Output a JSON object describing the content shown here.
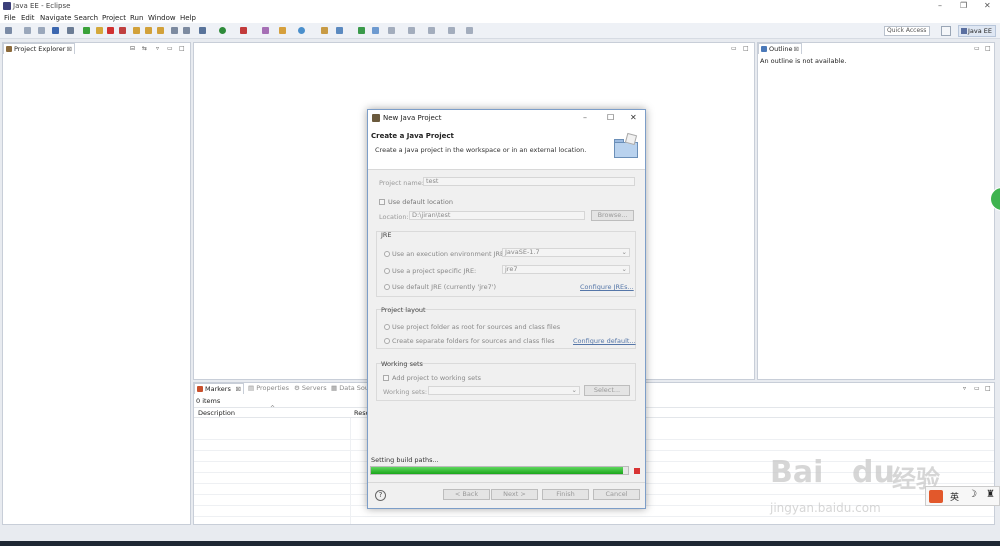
{
  "window": {
    "title": "Java EE - Eclipse"
  },
  "menu": [
    "File",
    "Edit",
    "Navigate",
    "Search",
    "Project",
    "Run",
    "Window",
    "Help"
  ],
  "toolbar": {
    "quick_access": "Quick Access",
    "perspective": "Java EE"
  },
  "project_explorer": {
    "tab": "Project Explorer"
  },
  "outline": {
    "tab": "Outline",
    "message": "An outline is not available."
  },
  "bottom": {
    "tabs": [
      "Markers",
      "Properties",
      "Servers",
      "Data Sou"
    ],
    "count": "0 items",
    "columns": [
      "Description",
      "Reso"
    ]
  },
  "dialog": {
    "title": "New Java Project",
    "heading": "Create a Java Project",
    "description": "Create a Java project in the workspace or in an external location.",
    "project_name_label": "Project name:",
    "project_name_value": "test",
    "use_default_location": "Use default location",
    "location_label": "Location:",
    "location_value": "D:\\jiran\\test",
    "browse": "Browse...",
    "jre": {
      "title": "JRE",
      "opt_exec_env": "Use an execution environment JRE:",
      "exec_env_value": "JavaSE-1.7",
      "opt_project_specific": "Use a project specific JRE:",
      "project_specific_value": "jre7",
      "opt_default": "Use default JRE (currently 'jre7')",
      "configure": "Configure JREs..."
    },
    "layout": {
      "title": "Project layout",
      "opt_root": "Use project folder as root for sources and class files",
      "opt_separate": "Create separate folders for sources and class files",
      "configure": "Configure default..."
    },
    "working_sets": {
      "title": "Working sets",
      "add": "Add project to working sets",
      "label": "Working sets:",
      "select": "Select..."
    },
    "status": "Setting build paths...",
    "progress": 0.98,
    "buttons": {
      "back": "< Back",
      "next": "Next >",
      "finish": "Finish",
      "cancel": "Cancel"
    }
  },
  "ime": {
    "lang": "英"
  },
  "watermark": {
    "line1": "Bai",
    "line2": "du",
    "line3": "经验",
    "line4": "jingyan.baidu.com"
  }
}
